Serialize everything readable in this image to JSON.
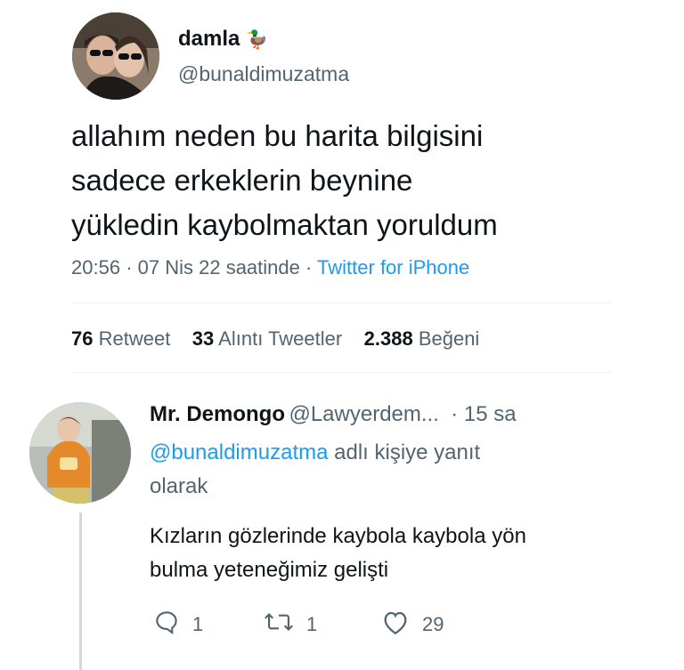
{
  "tweet": {
    "author_name": "damla",
    "author_emoji": "🦆",
    "author_handle": "@bunaldimuzatma",
    "text_lines": [
      "allahım neden bu harita bilgisini",
      "sadece erkeklerin beynine",
      "yükledin kaybolmaktan yoruldum"
    ],
    "time": "20:56",
    "date": "07 Nis 22 saatinde",
    "source": "Twitter for iPhone",
    "separator": "·",
    "stats": {
      "retweets_count": "76",
      "retweets_label": "Retweet",
      "quotes_count": "33",
      "quotes_label": "Alıntı Tweetler",
      "likes_count": "2.388",
      "likes_label": "Beğeni"
    }
  },
  "reply": {
    "author_name": "Mr. Demongo",
    "author_handle": "@Lawyerdem...",
    "time_ago": "· 15 sa",
    "replying_mention": "@bunaldimuzatma",
    "replying_suffix": "adlı kişiye yanıt",
    "replying_suffix2": "olarak",
    "text_lines": [
      "Kızların gözlerinde kaybola kaybola yön",
      "bulma yeteneğimiz gelişti"
    ],
    "actions": {
      "reply_count": "1",
      "retweet_count": "1",
      "like_count": "29"
    }
  },
  "colors": {
    "link": "#1d9bf0",
    "secondary_text": "#536471",
    "primary_text": "#0f1419"
  }
}
